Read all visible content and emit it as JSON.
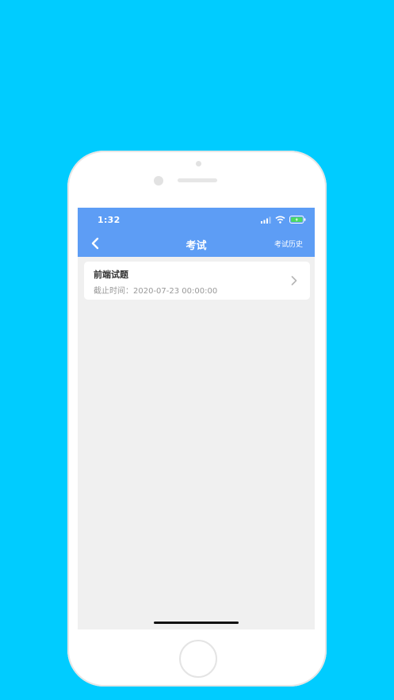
{
  "colors": {
    "background": "#00CCFF",
    "header": "#5D9DF5",
    "screen_bg": "#F0F0F0",
    "card_bg": "#FFFFFF",
    "battery": "#4CD964"
  },
  "status_bar": {
    "time": "1:32",
    "icons": [
      "signal-icon",
      "wifi-icon",
      "battery-icon"
    ]
  },
  "nav": {
    "back_icon": "chevron-left-icon",
    "title": "考试",
    "right_label": "考试历史"
  },
  "exams": [
    {
      "title": "前端试题",
      "deadline": "截止时间：2020-07-23 00:00:00",
      "arrow_icon": "chevron-right-icon"
    }
  ]
}
